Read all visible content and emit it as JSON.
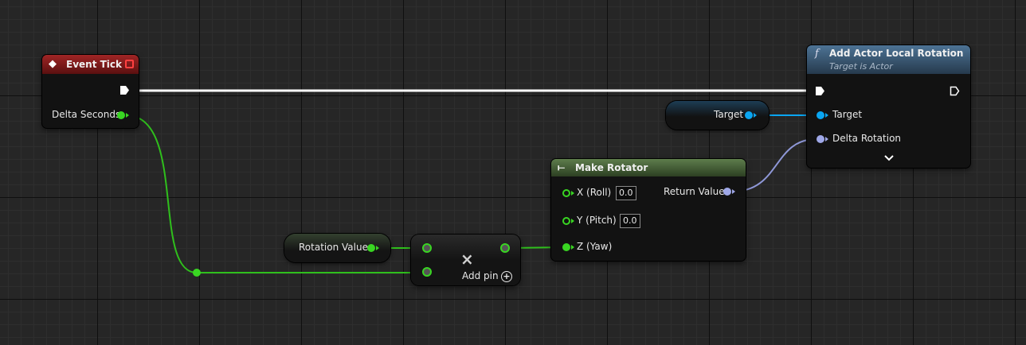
{
  "event_tick": {
    "title": "Event Tick",
    "delta_seconds": "Delta Seconds",
    "icon": "event-diamond-icon",
    "header_color": "#8a1c1c"
  },
  "add_rotation": {
    "title": "Add Actor Local Rotation",
    "subtitle": "Target is Actor",
    "target_label": "Target",
    "delta_rotation_label": "Delta Rotation",
    "icon": "function-icon",
    "header_color": "#3a5a78"
  },
  "target_var": {
    "label": "Target"
  },
  "make_rotator": {
    "title": "Make Rotator",
    "x_label": "X (Roll)",
    "x_value": "0.0",
    "y_label": "Y (Pitch)",
    "y_value": "0.0",
    "z_label": "Z (Yaw)",
    "return_label": "Return Value",
    "header_color": "#4d6a3e"
  },
  "rotation_var": {
    "label": "Rotation Value"
  },
  "multiply": {
    "symbol": "×",
    "add_pin": "Add pin"
  },
  "colors": {
    "float_pin": "#39d622",
    "object_pin": "#0aa6f2",
    "struct_pin": "#9fa8e8",
    "exec_wire": "#ffffff"
  }
}
